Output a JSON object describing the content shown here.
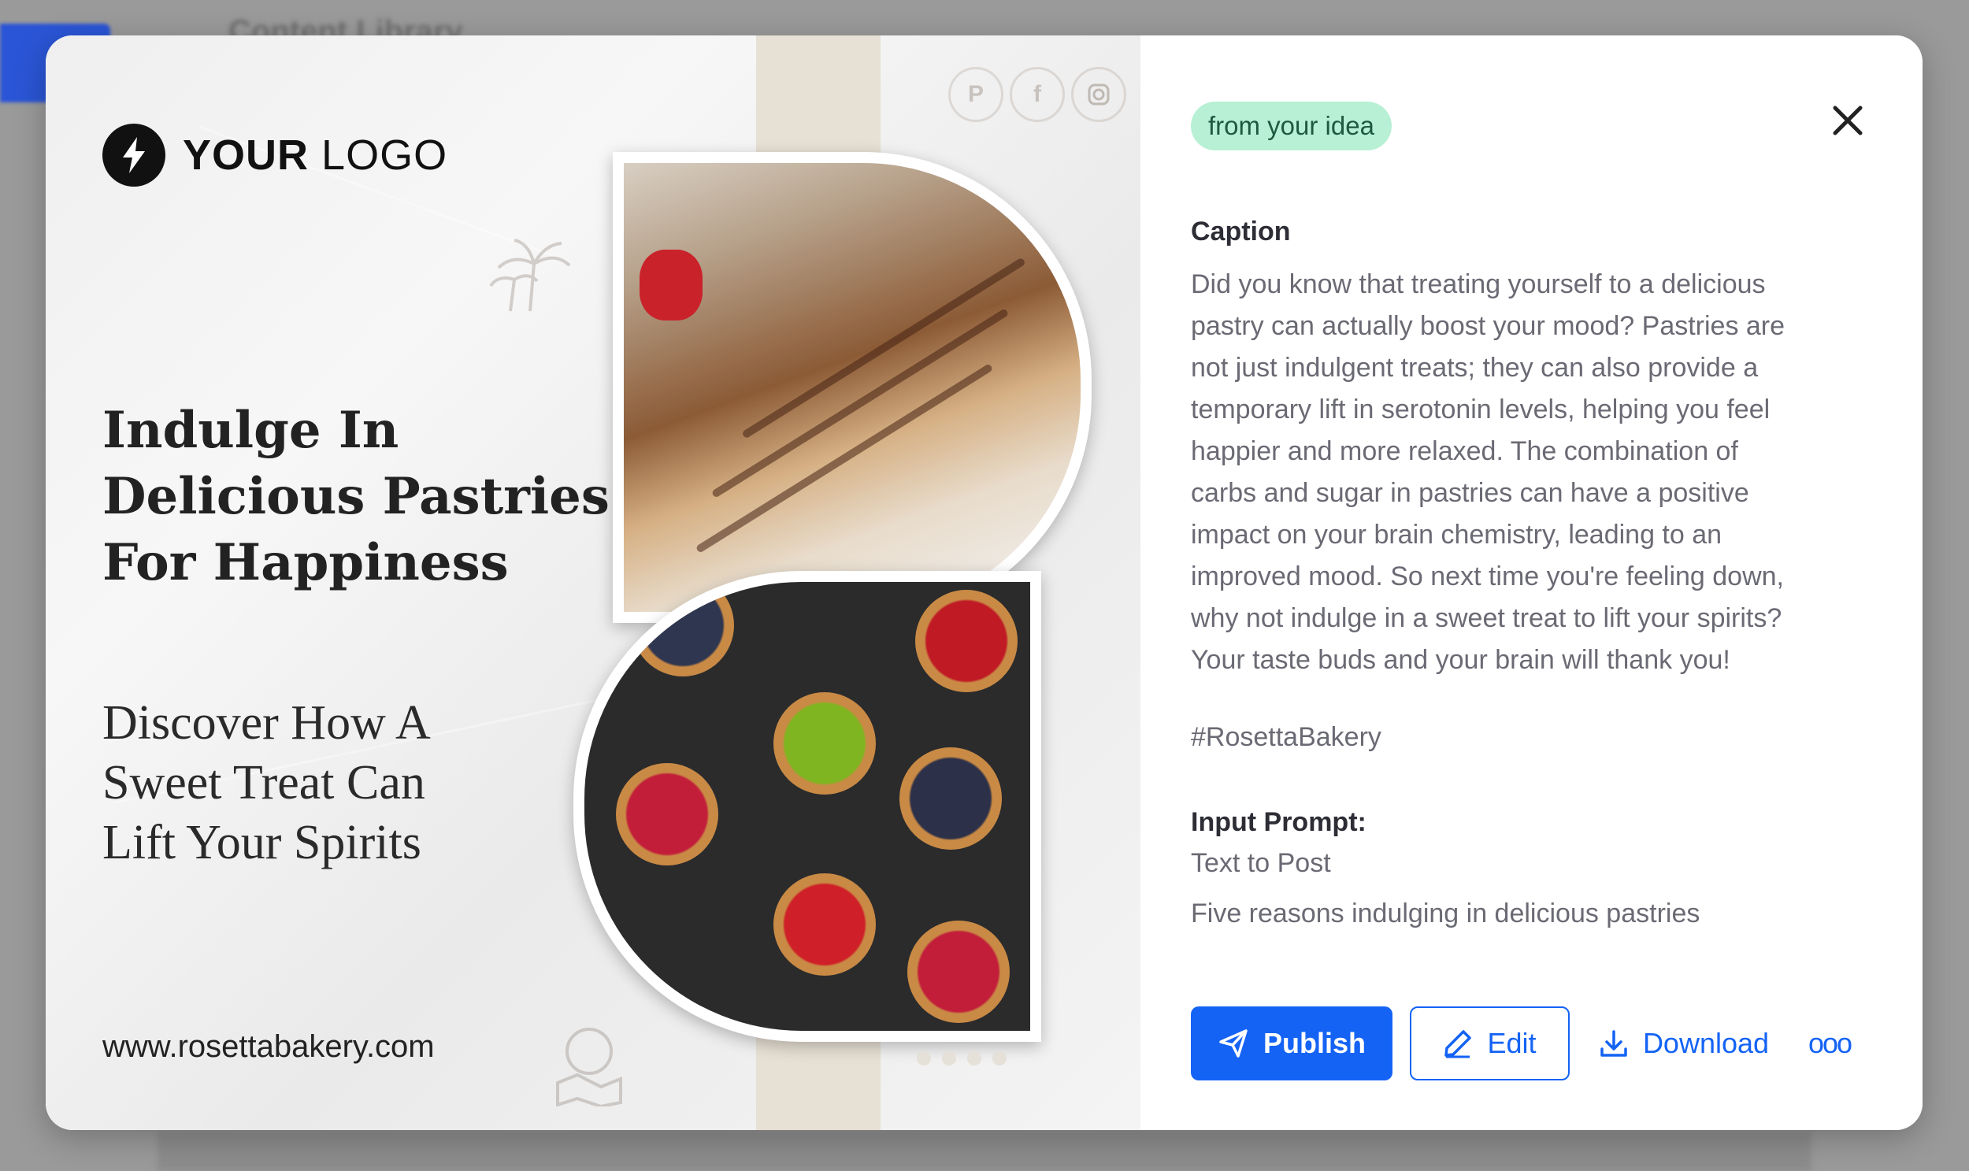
{
  "background": {
    "title": "Content Library"
  },
  "preview": {
    "logo_text_bold": "YOUR",
    "logo_text_light": "LOGO",
    "headline": [
      "Indulge In",
      "Delicious Pastries",
      "For Happiness"
    ],
    "subline": [
      "Discover How A",
      "Sweet Treat Can",
      "Lift Your Spirits"
    ],
    "website": "www.rosettabakery.com",
    "social_icons": [
      "pinterest-icon",
      "facebook-icon",
      "instagram-icon"
    ]
  },
  "panel": {
    "badge": "from your idea",
    "caption_label": "Caption",
    "caption_lines": [
      "Did you know that treating yourself to a delicious",
      "pastry can actually boost your mood? Pastries are",
      "not just indulgent treats; they can also provide a",
      "temporary lift in serotonin levels, helping you feel",
      "happier and more relaxed. The combination of",
      "carbs and sugar in pastries can have a positive",
      "impact on your brain chemistry, leading to an",
      "improved mood. So next time you're feeling down,",
      "why not indulge in a sweet treat to lift your spirits?",
      "Your taste buds and your brain will thank you!"
    ],
    "hashtag": "#RosettaBakery",
    "prompt_label": "Input Prompt:",
    "prompt_type": "Text to Post",
    "prompt_text": "Five reasons indulging in delicious pastries",
    "buttons": {
      "publish": "Publish",
      "edit": "Edit",
      "download": "Download",
      "more": "ooo"
    }
  },
  "colors": {
    "accent": "#1463f5",
    "badge_bg": "#b7f0d4",
    "badge_text": "#1e5a3f"
  }
}
